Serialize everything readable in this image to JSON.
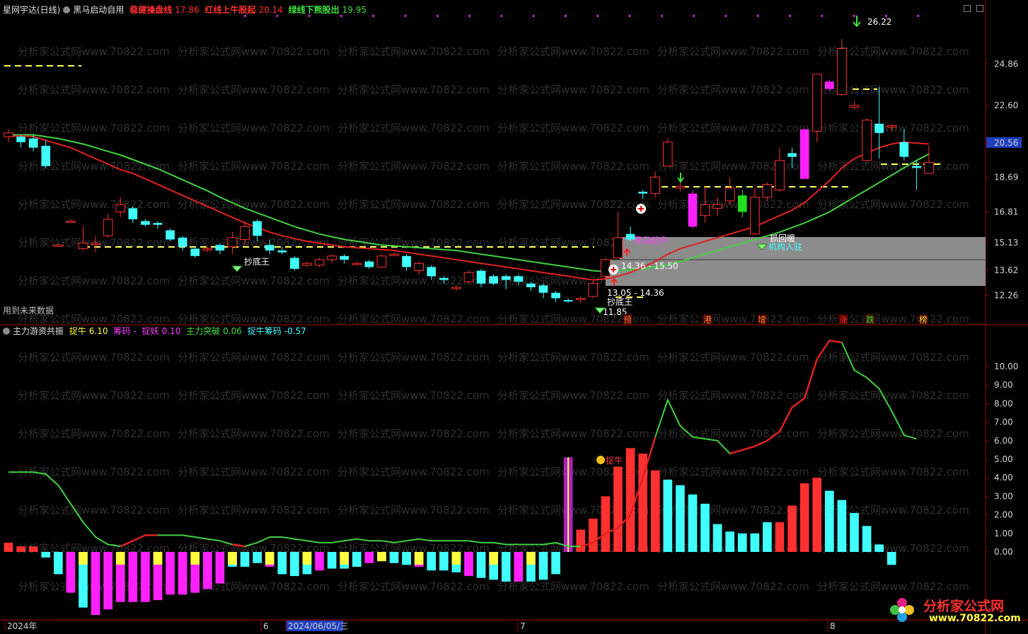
{
  "header": {
    "stock_name": "星网宇达(日线)",
    "indicator_name": "黑马启动自用",
    "lines": [
      {
        "label": "稳健操盘线",
        "value": "17.86",
        "color": "#ff3030"
      },
      {
        "label": "红线上牛股起",
        "value": "20.14",
        "color": "#ff3030"
      },
      {
        "label": "绿线下熊股出",
        "value": "19.95",
        "color": "#40e040"
      }
    ]
  },
  "sub_header": {
    "name": "主力游资共振",
    "items": [
      {
        "label": "捉牛",
        "value": "6.10",
        "color": "#ffff40"
      },
      {
        "label": "筹码",
        "value": "-",
        "color": "#ff40ff"
      },
      {
        "label": "捉妖",
        "value": "0.10",
        "color": "#ff40ff"
      },
      {
        "label": "主力突破",
        "value": "0.06",
        "color": "#40e040"
      },
      {
        "label": "捉牛筹码",
        "value": "-0.57",
        "color": "#40ffff"
      }
    ]
  },
  "future_data_note": "用到未来数据",
  "price_axis": {
    "ticks": [
      "24.86",
      "22.60",
      "20.56",
      "18.69",
      "16.81",
      "15.13",
      "13.62",
      "12.26"
    ],
    "highlight": "20.56",
    "highlight_color": "#1f3fbf"
  },
  "sub_axis": {
    "ticks": [
      "10.00",
      "9.00",
      "8.00",
      "7.00",
      "6.00",
      "5.00",
      "4.00",
      "3.00",
      "2.00",
      "1.00",
      "0.00"
    ]
  },
  "date_axis": {
    "labels": [
      "2024年",
      "6",
      "2024/06/05/三",
      "7",
      "8"
    ]
  },
  "annotations": {
    "max_price": "26.22",
    "min_price": "11.85",
    "chou_di_wang_1": "抄底王",
    "chou_di_wang_2": "抄底王",
    "range_1": "14.36 - 15.50",
    "range_2": "13.05 - 14.36",
    "hei_ma_qi_sheng": "黑马起升",
    "zhua_hui_nuan": "抓回暖",
    "ji_gou_ru_zhu": "机构入驻",
    "zhuo_niu": "捉牛",
    "bottom_marks": [
      {
        "text": "预",
        "color": "#ff8040"
      },
      {
        "text": "港",
        "color": "#ff8040"
      },
      {
        "text": "增",
        "color": "#ff8040"
      },
      {
        "text": "涨",
        "color": "#ff3030"
      },
      {
        "text": "跌",
        "color": "#40e040"
      },
      {
        "text": "榜",
        "color": "#ffd040"
      }
    ]
  },
  "watermark_text": "分析家公式网www.70822.com",
  "logo": {
    "title": "分析家公式网",
    "url": "www.70822.com"
  },
  "colors": {
    "up": "#ff3030",
    "down": "#40ffff",
    "ma_red": "#e02020",
    "ma_green": "#40d040",
    "magenta": "#ff20ff",
    "yellow": "#ffff40"
  },
  "chart_data": {
    "type": "candlestick",
    "series_note": "daily OHLC, estimated from axis",
    "candles": [
      [
        20.9,
        21.1,
        20.6,
        21.3
      ],
      [
        20.9,
        20.6,
        20.3,
        21.0
      ],
      [
        20.8,
        20.3,
        20.1,
        21.0
      ],
      [
        20.4,
        19.3,
        19.2,
        20.7
      ],
      [
        15.0,
        15.0,
        14.9,
        15.1
      ],
      [
        16.3,
        16.3,
        16.2,
        16.4
      ],
      [
        14.8,
        15.1,
        14.7,
        16.0
      ],
      [
        15.1,
        15.1,
        14.6,
        15.5
      ],
      [
        15.5,
        16.4,
        15.4,
        16.7
      ],
      [
        16.8,
        17.2,
        16.5,
        17.6
      ],
      [
        17.0,
        16.4,
        16.2,
        17.1
      ],
      [
        16.3,
        16.1,
        16.0,
        16.4
      ],
      [
        16.2,
        16.1,
        15.9,
        16.3
      ],
      [
        15.8,
        15.3,
        15.2,
        15.9
      ],
      [
        15.4,
        14.9,
        14.7,
        15.5
      ],
      [
        14.8,
        14.4,
        14.3,
        14.9
      ],
      [
        14.8,
        14.8,
        14.6,
        14.9
      ],
      [
        15.0,
        14.7,
        14.5,
        15.1
      ],
      [
        14.9,
        15.4,
        14.5,
        15.7
      ],
      [
        15.3,
        16.0,
        15.0,
        16.3
      ],
      [
        16.3,
        15.5,
        15.2,
        16.4
      ],
      [
        15.0,
        14.7,
        14.5,
        15.3
      ],
      [
        14.7,
        14.6,
        14.5,
        14.9
      ],
      [
        14.3,
        13.7,
        13.6,
        14.4
      ],
      [
        13.9,
        14.0,
        13.8,
        14.1
      ],
      [
        13.9,
        14.2,
        13.8,
        14.3
      ],
      [
        14.2,
        14.4,
        14.0,
        14.5
      ],
      [
        14.4,
        14.2,
        14.0,
        14.5
      ],
      [
        14.0,
        14.0,
        13.9,
        14.1
      ],
      [
        14.1,
        13.8,
        13.7,
        14.2
      ],
      [
        13.8,
        14.4,
        13.8,
        14.5
      ],
      [
        14.5,
        14.5,
        14.4,
        14.6
      ],
      [
        14.4,
        13.8,
        13.6,
        14.5
      ],
      [
        13.6,
        14.0,
        13.4,
        14.1
      ],
      [
        13.8,
        13.3,
        13.1,
        13.9
      ],
      [
        13.2,
        13.1,
        12.9,
        13.3
      ],
      [
        12.7,
        12.7,
        12.5,
        12.8
      ],
      [
        13.0,
        13.5,
        12.9,
        13.6
      ],
      [
        13.6,
        12.9,
        12.7,
        13.7
      ],
      [
        13.3,
        12.9,
        12.8,
        13.4
      ],
      [
        13.3,
        13.1,
        12.6,
        13.4
      ],
      [
        13.3,
        13.0,
        12.8,
        13.4
      ],
      [
        12.9,
        12.7,
        12.5,
        13.0
      ],
      [
        12.8,
        12.4,
        12.1,
        12.9
      ],
      [
        12.4,
        12.1,
        11.9,
        12.5
      ],
      [
        12.0,
        11.95,
        11.85,
        12.1
      ],
      [
        12.1,
        12.1,
        11.85,
        12.2
      ],
      [
        12.2,
        12.9,
        12.1,
        13.0
      ],
      [
        13.3,
        14.2,
        13.1,
        14.3
      ],
      [
        14.3,
        15.4,
        14.3,
        16.8
      ],
      [
        15.6,
        15.3,
        15.2,
        16.0
      ],
      [
        17.9,
        17.8,
        17.5,
        18.0
      ],
      [
        17.8,
        18.7,
        17.6,
        19.0
      ],
      [
        19.3,
        20.6,
        19.3,
        20.8
      ],
      [
        18.1,
        18.2,
        17.9,
        18.4
      ],
      [
        16.0,
        17.8,
        15.9,
        18.0
      ],
      [
        16.6,
        17.2,
        16.2,
        18.2
      ],
      [
        17.0,
        17.2,
        16.6,
        17.6
      ],
      [
        17.4,
        18.1,
        17.2,
        18.7
      ],
      [
        17.7,
        16.8,
        16.5,
        18.0
      ],
      [
        15.6,
        17.6,
        15.6,
        18.1
      ],
      [
        17.6,
        18.3,
        17.4,
        18.4
      ],
      [
        18.0,
        19.6,
        17.9,
        20.3
      ],
      [
        20.0,
        19.8,
        19.2,
        20.3
      ],
      [
        18.6,
        21.3,
        18.6,
        21.3
      ],
      [
        21.2,
        24.3,
        20.6,
        24.3
      ],
      [
        23.5,
        23.9,
        23.4,
        24.0
      ],
      [
        23.2,
        25.7,
        23.1,
        26.22
      ],
      [
        22.5,
        22.6,
        22.4,
        22.8
      ],
      [
        19.6,
        21.8,
        19.6,
        21.9
      ],
      [
        21.6,
        21.1,
        19.7,
        23.6
      ],
      [
        21.5,
        21.5,
        21.2,
        21.6
      ],
      [
        20.6,
        19.8,
        19.6,
        21.3
      ],
      [
        19.3,
        19.2,
        18.0,
        19.6
      ],
      [
        18.9,
        19.5,
        18.9,
        20.4
      ]
    ],
    "ma_red": [
      20.9,
      20.95,
      20.9,
      20.7,
      20.5,
      20.3,
      20.0,
      19.7,
      19.4,
      19.1,
      18.9,
      18.6,
      18.3,
      18.0,
      17.7,
      17.4,
      17.1,
      16.8,
      16.5,
      16.2,
      15.95,
      15.7,
      15.5,
      15.35,
      15.2,
      15.1,
      15.0,
      14.9,
      14.85,
      14.8,
      14.75,
      14.7,
      14.6,
      14.5,
      14.4,
      14.3,
      14.2,
      14.1,
      14.0,
      13.9,
      13.8,
      13.7,
      13.6,
      13.5,
      13.4,
      13.3,
      13.2,
      13.1,
      13.15,
      13.3,
      13.5,
      13.8,
      14.1,
      14.5,
      14.8,
      15.0,
      15.2,
      15.4,
      15.6,
      15.8,
      16.0,
      16.3,
      16.6,
      16.9,
      17.3,
      17.9,
      18.5,
      19.2,
      19.7,
      20.0,
      20.3,
      20.5,
      20.6,
      20.55,
      20.5
    ],
    "ma_green": [
      21.0,
      21.0,
      21.0,
      20.9,
      20.8,
      20.65,
      20.5,
      20.3,
      20.1,
      19.9,
      19.65,
      19.4,
      19.15,
      18.85,
      18.55,
      18.25,
      17.95,
      17.6,
      17.3,
      17.0,
      16.75,
      16.5,
      16.25,
      16.0,
      15.8,
      15.6,
      15.45,
      15.3,
      15.2,
      15.1,
      15.0,
      14.95,
      14.9,
      14.85,
      14.8,
      14.75,
      14.7,
      14.6,
      14.5,
      14.4,
      14.3,
      14.2,
      14.1,
      14.0,
      13.9,
      13.8,
      13.7,
      13.6,
      13.55,
      13.6,
      13.65,
      13.7,
      13.8,
      13.9,
      14.1,
      14.3,
      14.5,
      14.7,
      14.9,
      15.1,
      15.3,
      15.5,
      15.7,
      15.95,
      16.2,
      16.5,
      16.8,
      17.2,
      17.6,
      18.0,
      18.4,
      18.8,
      19.2,
      19.6,
      19.95
    ],
    "sub_series": {
      "line": [
        4.3,
        4.3,
        4.3,
        4.2,
        3.6,
        2.6,
        1.6,
        0.8,
        0.4,
        0.3,
        0.6,
        0.9,
        0.9,
        0.9,
        0.9,
        0.8,
        0.7,
        0.6,
        0.4,
        0.3,
        0.5,
        0.8,
        0.8,
        0.7,
        0.6,
        0.5,
        0.5,
        0.6,
        0.7,
        0.6,
        0.6,
        0.5,
        0.6,
        0.7,
        0.6,
        0.6,
        0.6,
        0.6,
        0.5,
        0.5,
        0.4,
        0.4,
        0.4,
        0.4,
        0.5,
        0.3,
        0.3,
        0.5,
        1.0,
        1.3,
        2.0,
        4.0,
        6.2,
        8.2,
        6.8,
        6.2,
        6.1,
        6.0,
        5.3,
        5.5,
        5.7,
        6.0,
        6.5,
        7.8,
        8.3,
        10.4,
        11.4,
        11.3,
        9.8,
        9.4,
        8.8,
        7.6,
        6.3,
        6.1
      ],
      "bars": [
        0.5,
        0.3,
        0.3,
        -0.3,
        -1.2,
        -2.2,
        -3.0,
        -3.4,
        -3.1,
        -2.7,
        -2.7,
        -2.7,
        -2.6,
        -2.3,
        -2.3,
        -2.2,
        -2.0,
        -1.7,
        -0.8,
        -0.8,
        -0.6,
        -0.8,
        -1.2,
        -1.3,
        -1.2,
        -1.0,
        -0.9,
        -0.9,
        -0.8,
        -0.6,
        -0.5,
        -0.6,
        -0.7,
        -0.8,
        -1.0,
        -1.0,
        -1.1,
        -1.3,
        -1.4,
        -1.5,
        -1.6,
        -1.6,
        -1.6,
        -1.5,
        -1.2,
        5.1,
        1.2,
        1.8,
        3.0,
        4.6,
        5.6,
        5.3,
        4.4,
        3.9,
        3.6,
        3.1,
        2.6,
        1.5,
        1.1,
        1.0,
        1.0,
        1.6,
        1.6,
        2.5,
        3.7,
        4.0,
        3.3,
        2.8,
        2.1,
        1.4,
        0.4,
        -0.7
      ]
    }
  }
}
